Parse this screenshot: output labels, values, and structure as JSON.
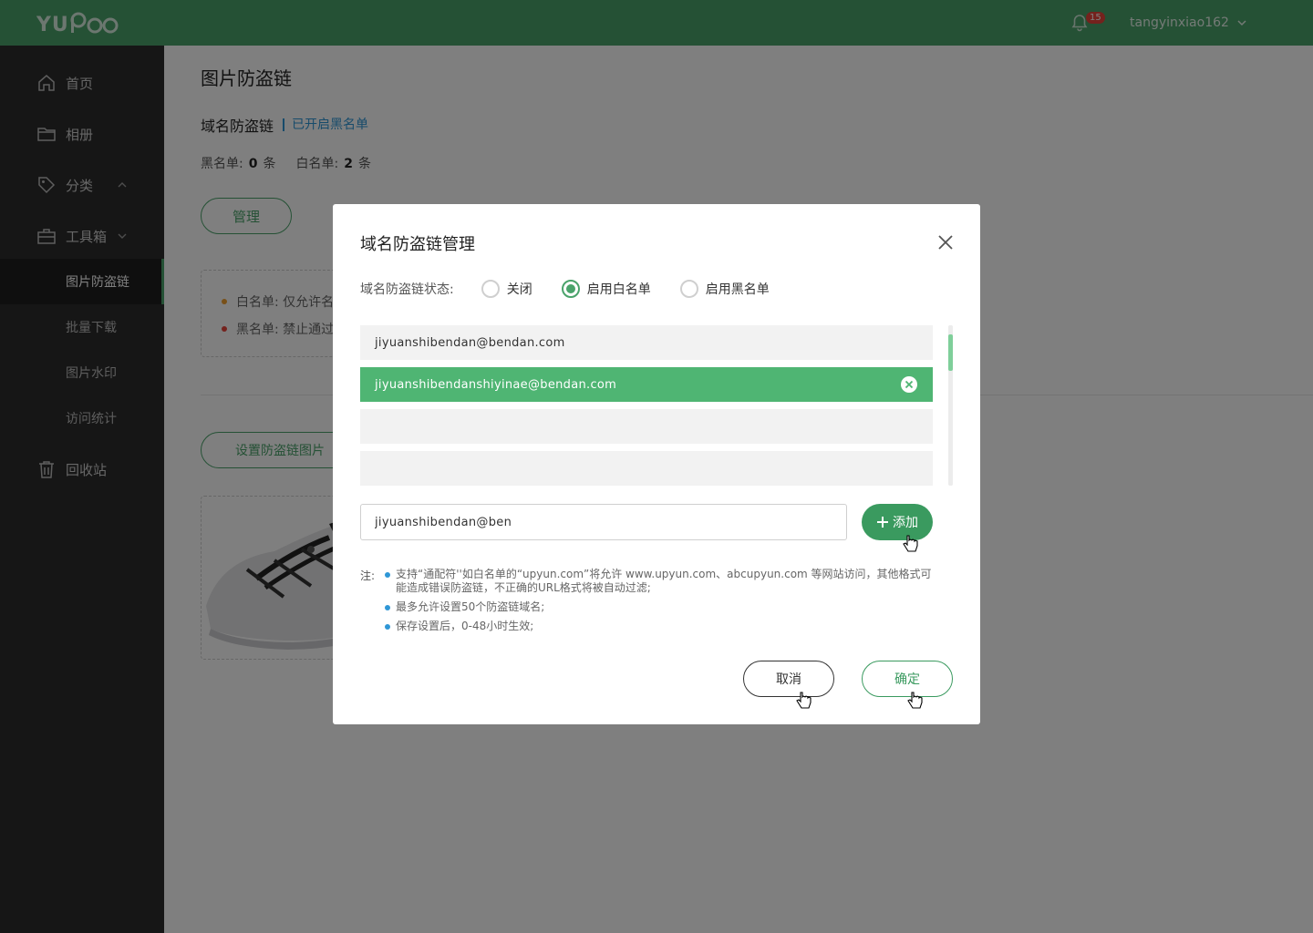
{
  "header": {
    "logo_text": "YUPOO",
    "notification_count": "15",
    "username": "tangyinxiao162"
  },
  "sidebar": {
    "items": [
      {
        "label": "首页",
        "icon": "home-icon"
      },
      {
        "label": "相册",
        "icon": "folder-icon"
      },
      {
        "label": "分类",
        "icon": "tag-icon"
      },
      {
        "label": "工具箱",
        "icon": "toolbox-icon"
      },
      {
        "label": "回收站",
        "icon": "trash-icon"
      }
    ],
    "toolbox_sub": [
      {
        "label": "图片防盗链",
        "active": true
      },
      {
        "label": "批量下载",
        "active": false
      },
      {
        "label": "图片水印",
        "active": false
      },
      {
        "label": "访问统计",
        "active": false
      }
    ]
  },
  "main": {
    "page_title": "图片防盗链",
    "section_title": "域名防盗链",
    "section_status": "已开启黑名单",
    "blacklist_label": "黑名单:",
    "blacklist_count": "0",
    "whitelist_label": "白名单:",
    "whitelist_count": "2",
    "count_unit": "条",
    "manage_label": "管理",
    "rule_whitelist": "白名单: 仅允许名",
    "rule_blacklist": "黑名单: 禁止通过",
    "set_image_label": "设置防盗链图片"
  },
  "modal": {
    "title": "域名防盗链管理",
    "status_label": "域名防盗链状态:",
    "options": [
      "关闭",
      "启用白名单",
      "启用黑名单"
    ],
    "selected_option": "启用白名单",
    "domains": [
      "jiyuanshibendan@bendan.com",
      "jiyuanshibendanshiyinae@bendan.com",
      "",
      ""
    ],
    "input_value": "jiyuanshibendan@ben",
    "add_label": "添加",
    "note_label": "注:",
    "notes": [
      "支持“通配符''如白名单的“upyun.com”将允许 www.upyun.com、abcupyun.com 等网站访问，其他格式可能造成错误防盗链，不正确的URL格式将被自动过滤;",
      "最多允许设置50个防盗链域名;",
      "保存设置后，0-48小时生效;"
    ],
    "cancel_label": "取消",
    "confirm_label": "确定"
  },
  "colors": {
    "brand_green": "#4aa36b",
    "selected_row": "#4fb573",
    "sidebar_bg": "#2c2c2c",
    "info_blue": "#2f97d6",
    "badge_red": "#e8443a"
  }
}
